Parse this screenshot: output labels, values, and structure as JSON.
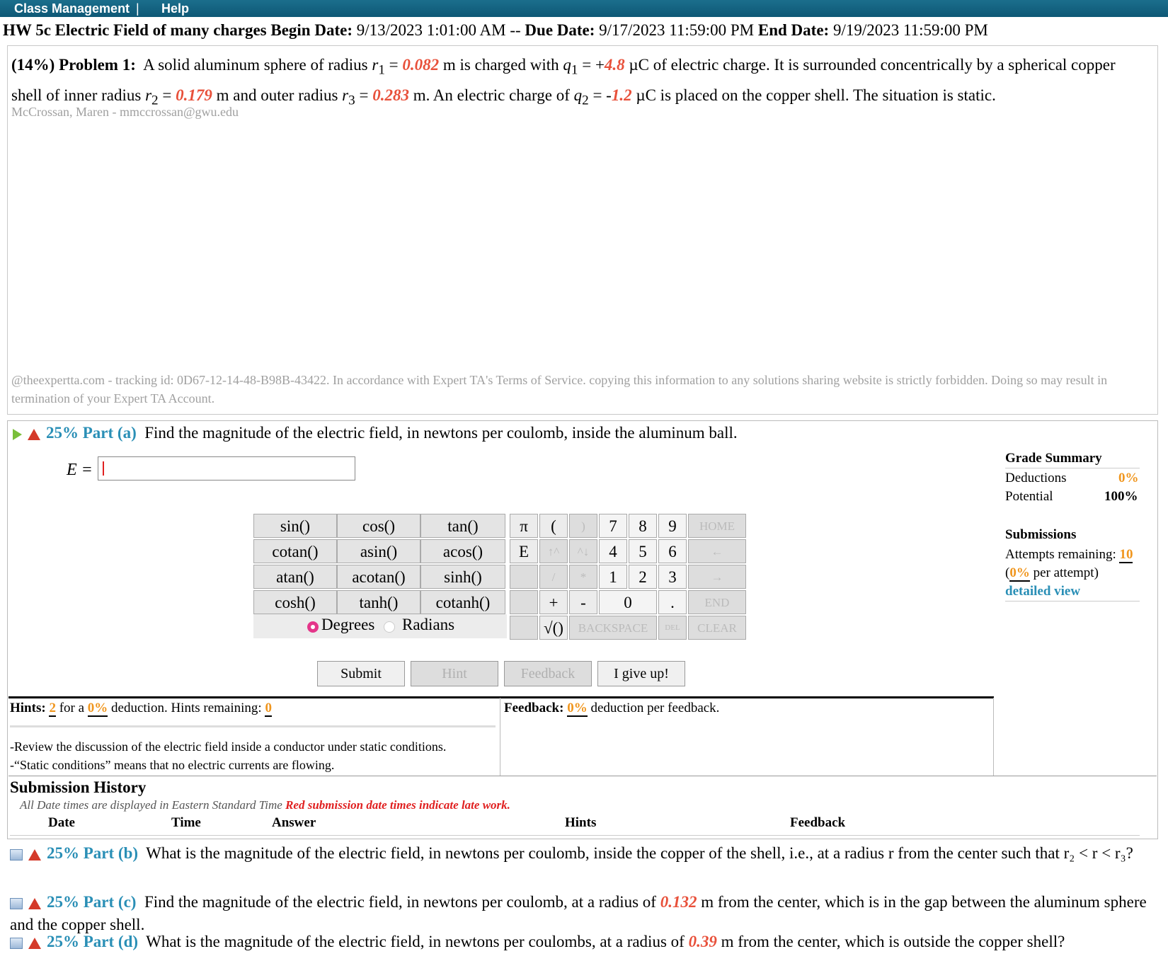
{
  "topbar": {
    "class_management": "Class Management",
    "separator": "|",
    "help": "Help"
  },
  "header": {
    "title": "HW 5c Electric Field of many charges",
    "begin_label": "Begin Date:",
    "begin_value": "9/13/2023 1:01:00 AM",
    "dash": "--",
    "due_label": "Due Date:",
    "due_value": "9/17/2023 11:59:00 PM",
    "end_label": "End Date:",
    "end_value": "9/19/2023 11:59:00 PM"
  },
  "problem": {
    "weight": "(14%)",
    "label": "Problem 1:",
    "t1": "A solid aluminum sphere of radius ",
    "r1_sym": "r",
    "r1_sub": "1",
    "eq": " = ",
    "r1_val": "0.082",
    "t2": " m is charged with ",
    "q1_sym": "q",
    "q1_sub": "1",
    "q1_sign": " = +",
    "q1_val": "4.8",
    "t3": " µC of electric charge. It is surrounded concentrically by a spherical copper shell of inner radius ",
    "r2_sym": "r",
    "r2_sub": "2",
    "r2_val": "0.179",
    "t4": " m and outer radius ",
    "r3_sym": "r",
    "r3_sub": "3",
    "r3_val": "0.283",
    "t5": " m. An electric charge of ",
    "q2_sym": "q",
    "q2_sub": "2",
    "q2_sign": " = -",
    "q2_val": "1.2",
    "t6": " µC is placed on the copper shell. The situation is static.",
    "student": "McCrossan, Maren - mmccrossan@gwu.edu",
    "tracking": "@theexpertta.com - tracking id: 0D67-12-14-48-B98B-43422. In accordance with Expert TA's Terms of Service. copying this information to any solutions sharing website is strictly forbidden. Doing so may result in termination of your Expert TA Account."
  },
  "part_a": {
    "pct": "25%",
    "label": "Part (a)",
    "question": "Find the magnitude of the electric field, in newtons per coulomb, inside the aluminum ball.",
    "eq_label": "E =",
    "input_value": ""
  },
  "calculator": {
    "func_keys": [
      "sin()",
      "cos()",
      "tan()",
      "cotan()",
      "asin()",
      "acos()",
      "atan()",
      "acotan()",
      "sinh()",
      "cosh()",
      "tanh()",
      "cotanh()"
    ],
    "pi": "π",
    "e": "E",
    "lparen": "(",
    "rparen": ")",
    "up": "↑^",
    "down": "^↓",
    "slash": "/",
    "star": "*",
    "plus": "+",
    "minus": "-",
    "sqrt": "√()",
    "digits": [
      "7",
      "8",
      "9",
      "4",
      "5",
      "6",
      "1",
      "2",
      "3",
      "0",
      "."
    ],
    "home": "HOME",
    "left": "←",
    "right": "→",
    "end": "END",
    "backspace": "BACKSPACE",
    "del": "DEL",
    "clear": "CLEAR",
    "degrees": "Degrees",
    "radians": "Radians"
  },
  "buttons": {
    "submit": "Submit",
    "hint": "Hint",
    "feedback": "Feedback",
    "give_up": "I give up!"
  },
  "grade_summary": {
    "title": "Grade Summary",
    "deductions_label": "Deductions",
    "deductions_value": "0%",
    "potential_label": "Potential",
    "potential_value": "100%",
    "submissions_title": "Submissions",
    "attempts_label": "Attempts remaining:",
    "attempts_value": "10",
    "per_attempt_open": "(",
    "per_attempt_value": "0%",
    "per_attempt_close": " per attempt)",
    "detailed_view": "detailed view"
  },
  "hints": {
    "label": "Hints:",
    "count": "2",
    "for_a": "for a",
    "deduction": "0%",
    "deduction_text": "deduction. Hints remaining:",
    "remaining": "0",
    "hint1": "-Review the discussion of the electric field inside a conductor under static conditions.",
    "hint2": "-“Static conditions” means that no electric currents are flowing."
  },
  "feedback": {
    "label": "Feedback:",
    "value": "0%",
    "text": "deduction per feedback."
  },
  "submission_history": {
    "title": "Submission History",
    "note": "All Date times are displayed in Eastern Standard Time",
    "late_note": "Red submission date times indicate late work.",
    "columns": [
      "Date",
      "Time",
      "Answer",
      "Hints",
      "Feedback"
    ]
  },
  "other_parts": [
    {
      "pct": "25%",
      "label": "Part (b)",
      "text": "What is the magnitude of the electric field, in newtons per coulomb, inside the copper of the shell, i.e., at a radius r from the center such that r₂ < r < r₃?"
    },
    {
      "pct": "25%",
      "label": "Part (c)",
      "text_a": "Find the magnitude of the electric field, in newtons per coulomb, at a radius of ",
      "value": "0.132",
      "text_b": " m from the center, which is in the gap between the aluminum sphere and the copper shell."
    },
    {
      "pct": "25%",
      "label": "Part (d)",
      "text_a": "What is the magnitude of the electric field, in newtons per coulombs, at a radius of ",
      "value": "0.39",
      "text_b": " m from the center, which is outside the copper shell?"
    }
  ],
  "colors": {
    "topbar": "#0e5876",
    "teal": "#2a8fb6",
    "orange": "#f0961e",
    "red_value": "#e8503a",
    "radio": "#e4368a"
  }
}
